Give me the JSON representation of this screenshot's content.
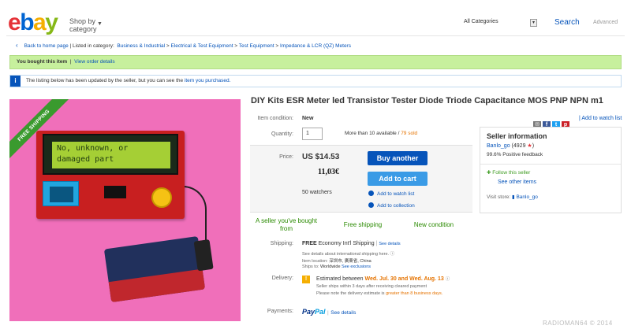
{
  "header": {
    "logo": [
      "e",
      "b",
      "a",
      "y"
    ],
    "shop_by_line1": "Shop by",
    "shop_by_line2": "category",
    "category_select": "All Categories",
    "search_label": "Search",
    "advanced_label": "Advanced"
  },
  "breadcrumb": {
    "back": "Back to home page",
    "listed_in": "| Listed in category:",
    "items": [
      "Business & Industrial",
      "Electrical & Test Equipment",
      "Test Equipment",
      "Impedance & LCR (QZ) Meters"
    ]
  },
  "bought_bar": {
    "text": "You bought this item",
    "sep": "|",
    "link": "View order details"
  },
  "info_bar": {
    "icon": "i",
    "text": "The listing below has been updated by the seller, but you can see the",
    "link": "item you purchased."
  },
  "product_image": {
    "ribbon": "FREE SHIPPING",
    "lcd_line1": "No, unknown, or",
    "lcd_line2": "damaged part"
  },
  "item": {
    "title": "DIY Kits ESR Meter led Transistor Tester Diode Triode Capacitance MOS PNP NPN m1",
    "condition_label": "Item condition:",
    "condition_value": "New",
    "quantity_label": "Quantity:",
    "quantity_value": "1",
    "availability": "More than 10 available",
    "sold": "79 sold",
    "price_label": "Price:",
    "price_usd": "US $14.53",
    "price_eur": "11,03€",
    "buy_another": "Buy another",
    "add_to_cart": "Add to cart",
    "watchers": "50 watchers",
    "add_watch": "Add to watch list",
    "add_collection": "Add to collection"
  },
  "highlights": [
    "A seller you've bought from",
    "Free shipping",
    "New condition"
  ],
  "top_links": {
    "watch": "Add to watch list"
  },
  "seller": {
    "heading": "Seller information",
    "name": "Banlo_go",
    "feedback": "4929",
    "positive": "99.6% Positive feedback",
    "follow": "Follow this seller",
    "other_items": "See other items",
    "visit_store_label": "Visit store:",
    "store_name": "Banlo_go"
  },
  "shipping": {
    "label": "Shipping:",
    "free": "FREE",
    "method": "Economy Int'l Shipping",
    "see_details": "See details",
    "intl_note": "See details about international shipping here.",
    "location_label": "Item location:",
    "location": "深圳市, 廣東省, China",
    "ships_to_label": "Ships to:",
    "ships_to": "Worldwide",
    "see_exclusions": "See exclusions"
  },
  "delivery": {
    "label": "Delivery:",
    "estimated": "Estimated between",
    "dates": "Wed. Jul. 30 and Wed. Aug. 13",
    "seller_ships": "Seller ships within 3 days after receiving cleared payment",
    "note_pre": "Please note the delivery estimate is",
    "note_highlight": "greater than 8 business days."
  },
  "payments": {
    "label": "Payments:",
    "paypal1": "Pay",
    "paypal2": "Pal",
    "see_details": "See details"
  },
  "watermark": "RADIOMAN64 © 2014"
}
